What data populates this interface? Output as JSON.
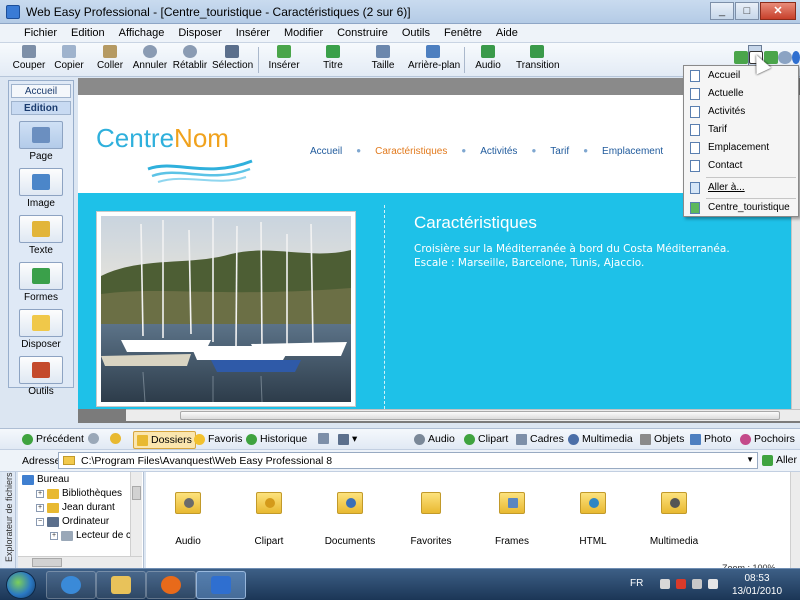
{
  "window": {
    "title": "Web Easy Professional - [Centre_touristique - Caractéristiques (2 sur 6)]",
    "controls": [
      "_",
      "□",
      "✕"
    ]
  },
  "menubar": [
    "Fichier",
    "Edition",
    "Affichage",
    "Disposer",
    "Insérer",
    "Modifier",
    "Construire",
    "Outils",
    "Fenêtre",
    "Aide"
  ],
  "toolbar": {
    "couper": "Couper",
    "copier": "Copier",
    "coller": "Coller",
    "annuler": "Annuler",
    "retablir": "Rétablir",
    "selection": "Sélection",
    "inserer": "Insérer",
    "titre": "Titre",
    "taille": "Taille",
    "arriere_plan": "Arrière-plan",
    "audio": "Audio",
    "transition": "Transition"
  },
  "leftpanel": {
    "tabs": [
      "Accueil",
      "Edition"
    ],
    "items": [
      "Page",
      "Image",
      "Texte",
      "Formes",
      "Disposer",
      "Outils"
    ]
  },
  "site": {
    "logo_part1": "Centre",
    "logo_part2": "Nom",
    "nav": [
      "Accueil",
      "Caractéristiques",
      "Activités",
      "Tarif",
      "Emplacement"
    ],
    "content_title": "Caractéristiques",
    "content_line1": "Croisière sur la Méditerranée à bord du Costa Méditerranéa.",
    "content_line2": "Escale : Marseille, Barcelone, Tunis, Ajaccio."
  },
  "dropdown": {
    "pages": [
      "Accueil",
      "Actuelle",
      "Activités",
      "Tarif",
      "Emplacement",
      "Contact"
    ],
    "goto": "Aller à...",
    "project": "Centre_touristique"
  },
  "explorer_toolbar": {
    "precedent": "Précédent",
    "dossiers": "Dossiers",
    "favoris": "Favoris",
    "historique": "Historique",
    "audio": "Audio",
    "clipart": "Clipart",
    "cadres": "Cadres",
    "multimedia": "Multimedia",
    "objets": "Objets",
    "photo": "Photo",
    "pochoirs": "Pochoirs"
  },
  "address": {
    "label": "Adresse",
    "path": "C:\\Program Files\\Avanquest\\Web Easy Professional 8",
    "go": "Aller"
  },
  "side_label": "Explorateur de fichiers",
  "tree": [
    "Bureau",
    "Bibliothèques",
    "Jean durant",
    "Ordinateur",
    "Lecteur de c"
  ],
  "files": [
    "Audio",
    "Clipart",
    "Documents",
    "Favorites",
    "Frames",
    "HTML",
    "Multimedia"
  ],
  "zoom_label": "Zoom : 100%",
  "taskbar": {
    "lang": "FR",
    "time": "08:53",
    "date": "13/01/2010"
  },
  "colors": {
    "site_band": "#1ec1e8",
    "logo_blue": "#2fb0dc",
    "logo_orange": "#f0a21d",
    "nav_active": "#e27a1d"
  }
}
